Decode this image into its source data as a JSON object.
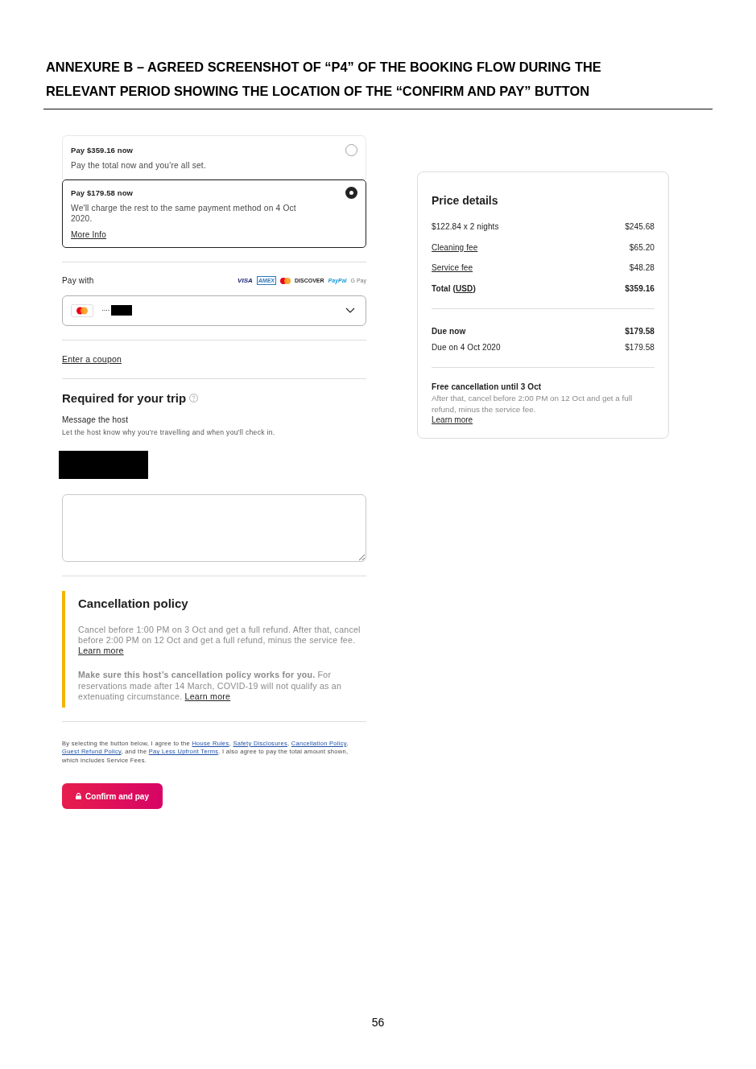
{
  "document": {
    "heading": "ANNEXURE B – AGREED SCREENSHOT OF “P4” OF THE BOOKING FLOW DURING THE RELEVANT PERIOD SHOWING THE LOCATION OF THE “CONFIRM AND PAY” BUTTON",
    "page_number": "56"
  },
  "payment_options": [
    {
      "title": "Pay $359.16 now",
      "description": "Pay the total now and you're all set.",
      "selected": false
    },
    {
      "title": "Pay $179.58 now",
      "description": "We'll charge the rest to the same payment method on 4 Oct 2020.",
      "link": "More Info",
      "selected": true
    }
  ],
  "pay_with": {
    "label": "Pay with",
    "accepted": [
      {
        "kind": "visa",
        "label": "VISA"
      },
      {
        "kind": "amex",
        "label": "AMEX"
      },
      {
        "kind": "mastercard"
      },
      {
        "kind": "discover",
        "label": "DISCOVER"
      },
      {
        "kind": "paypal",
        "label": "PayPal"
      },
      {
        "kind": "gpay",
        "label": "G Pay"
      }
    ],
    "selected_card": {
      "kind": "mastercard",
      "masked": "····",
      "redacted": true
    }
  },
  "coupon_link": "Enter a coupon",
  "required": {
    "title": "Required for your trip",
    "message_label": "Message the host",
    "description": "Let the host know why you're travelling and when you'll check in.",
    "redacted": true
  },
  "cancellation": {
    "title": "Cancellation policy",
    "paragraphs": [
      {
        "text": "Cancel before 1:00 PM on 3 Oct and get a full refund. After that, cancel before 2:00 PM on 12 Oct and get a full refund, minus the service fee.",
        "link": "Learn more"
      },
      {
        "text": "**Make sure this host’s cancellation policy works for you.** For reservations made after 14 March, COVID-19 will not qualify as an extenuating circumstance.",
        "link": "Learn more"
      }
    ]
  },
  "legal": [
    {
      "kind": "text",
      "text": "By selecting the button below, I agree to the "
    },
    {
      "kind": "link",
      "text": "House Rules"
    },
    {
      "kind": "text",
      "text": ", "
    },
    {
      "kind": "link",
      "text": "Safety Disclosures"
    },
    {
      "kind": "text",
      "text": ", "
    },
    {
      "kind": "link",
      "text": "Cancellation Policy"
    },
    {
      "kind": "text",
      "text": ", "
    },
    {
      "kind": "link",
      "text": "Guest Refund Policy"
    },
    {
      "kind": "text",
      "text": ", and the "
    },
    {
      "kind": "link",
      "text": "Pay Less Upfront Terms"
    },
    {
      "kind": "text",
      "text": ". I also agree to pay the total amount shown, which includes Service Fees."
    }
  ],
  "confirm_button": "Confirm and pay",
  "price_details": {
    "title": "Price details",
    "rows": [
      {
        "parts": [
          {
            "text": "$122.84 x 2 nights",
            "link": false
          }
        ],
        "amount": "$245.68",
        "bold": false
      },
      {
        "parts": [
          {
            "text": "Cleaning fee",
            "link": true
          }
        ],
        "amount": "$65.20",
        "bold": false
      },
      {
        "parts": [
          {
            "text": "Service fee",
            "link": true
          }
        ],
        "amount": "$48.28",
        "bold": false
      },
      {
        "parts": [
          {
            "text": "Total (",
            "link": false
          },
          {
            "text": "USD",
            "link": true
          },
          {
            "text": ")",
            "link": false
          }
        ],
        "amount": "$359.16",
        "bold": true
      }
    ],
    "due": [
      {
        "label": "Due now",
        "amount": "$179.58",
        "bold": true
      },
      {
        "label": "Due on 4 Oct 2020",
        "amount": "$179.58",
        "bold": false
      }
    ],
    "cancellation": {
      "title": "Free cancellation until 3 Oct",
      "text": "After that, cancel before 2:00 PM on 12 Oct and get a full refund, minus the service fee.",
      "link": "Learn more"
    }
  }
}
